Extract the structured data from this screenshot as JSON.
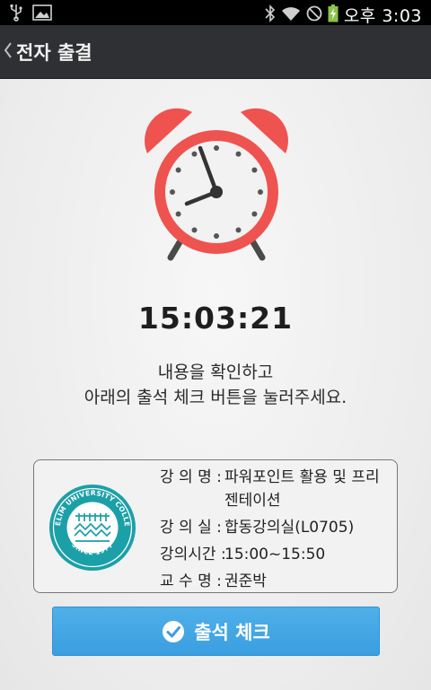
{
  "status_bar": {
    "time": "오후 3:03",
    "icons": [
      "usb-icon",
      "image-icon",
      "bluetooth-icon",
      "wifi-icon",
      "no-sync-icon",
      "battery-charging-icon"
    ]
  },
  "action_bar": {
    "title": "전자 출결",
    "back_icon": "chevron-left-icon"
  },
  "clock_time": "15:03:21",
  "instruction": {
    "line1": "내용을 확인하고",
    "line2": "아래의 출석 체크 버튼을 눌러주세요."
  },
  "course_card": {
    "logo": {
      "text_top": "DAELIM UNIVERSITY COLLEGE",
      "text_bottom": "SINCE 1977"
    },
    "rows": [
      {
        "label": "강 의 명 :",
        "value": "파워포인트 활용 및 프리젠테이션"
      },
      {
        "label": "강 의 실 :",
        "value": "합동강의실(L0705)"
      },
      {
        "label": "강의시간 :",
        "value": "15:00~15:50"
      },
      {
        "label": "교 수 명 :",
        "value": "권준박"
      }
    ]
  },
  "check_button": {
    "label": "출석 체크",
    "icon": "check-circle-icon"
  },
  "colors": {
    "clock_red": "#ef5350",
    "button_blue": "#43a6e6",
    "logo_teal": "#1ba0a8"
  }
}
